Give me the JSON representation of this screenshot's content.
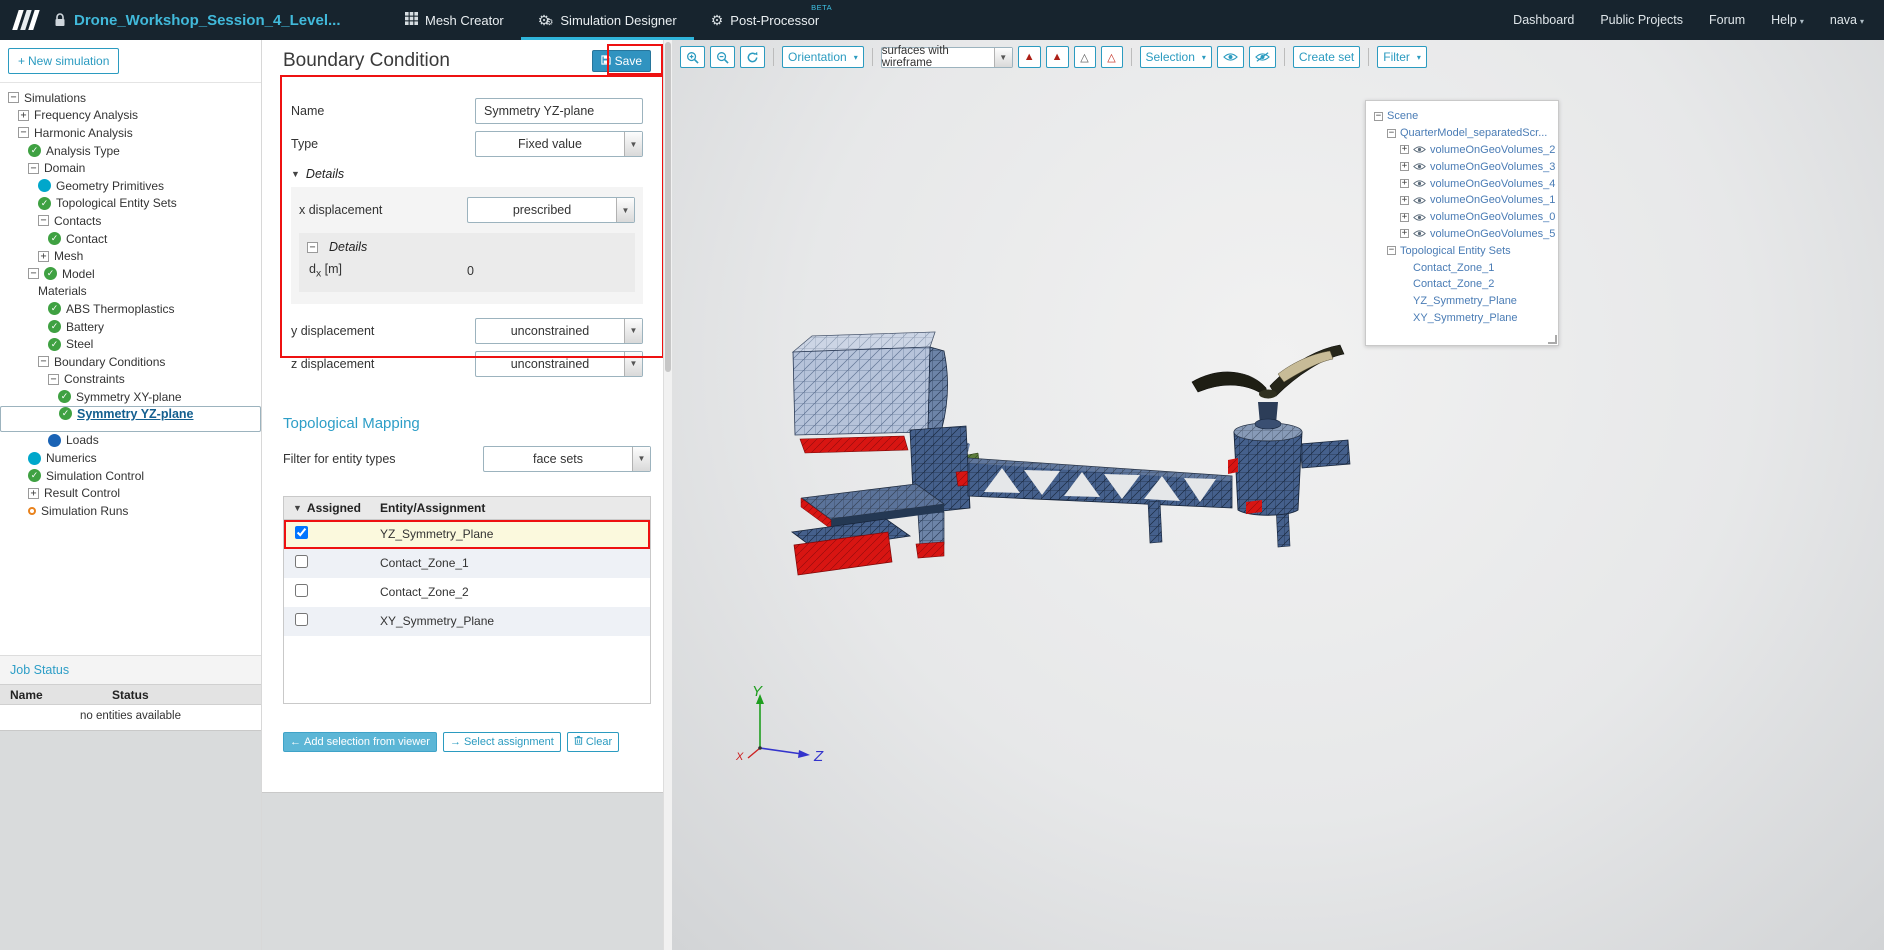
{
  "topbar": {
    "project_title": "Drone_Workshop_Session_4_Level...",
    "tabs": [
      {
        "label": "Mesh Creator"
      },
      {
        "label": "Simulation Designer"
      },
      {
        "label": "Post-Processor",
        "badge": "BETA"
      }
    ],
    "nav_links": [
      "Dashboard",
      "Public Projects",
      "Forum",
      "Help"
    ],
    "user_name": "nava"
  },
  "sidebar": {
    "new_simulation_label": "New simulation",
    "tree": [
      {
        "label": "Simulations",
        "depth": 0,
        "exp": "minus"
      },
      {
        "label": "Frequency Analysis",
        "depth": 1,
        "exp": "plus"
      },
      {
        "label": "Harmonic Analysis",
        "depth": 1,
        "exp": "minus"
      },
      {
        "label": "Analysis Type",
        "depth": 2,
        "status": "check"
      },
      {
        "label": "Domain",
        "depth": 2,
        "exp": "minus"
      },
      {
        "label": "Geometry Primitives",
        "depth": 3,
        "status": "dot-teal"
      },
      {
        "label": "Topological Entity Sets",
        "depth": 3,
        "status": "check"
      },
      {
        "label": "Contacts",
        "depth": 3,
        "exp": "minus"
      },
      {
        "label": "Contact",
        "depth": 4,
        "status": "check"
      },
      {
        "label": "Mesh",
        "depth": 3,
        "exp": "plus"
      },
      {
        "label": "Model",
        "depth": 2,
        "exp": "minus",
        "status": "check"
      },
      {
        "label": "Materials",
        "depth": 3
      },
      {
        "label": "ABS Thermoplastics",
        "depth": 4,
        "status": "check"
      },
      {
        "label": "Battery",
        "depth": 4,
        "status": "check"
      },
      {
        "label": "Steel",
        "depth": 4,
        "status": "check"
      },
      {
        "label": "Boundary Conditions",
        "depth": 3,
        "exp": "minus"
      },
      {
        "label": "Constraints",
        "depth": 4,
        "exp": "minus"
      },
      {
        "label": "Symmetry XY-plane",
        "depth": 5,
        "status": "check"
      },
      {
        "label": "Symmetry YZ-plane",
        "depth": 5,
        "status": "check",
        "selected": true
      },
      {
        "label": "Loads",
        "depth": 4,
        "status": "dot-blue"
      },
      {
        "label": "Numerics",
        "depth": 2,
        "status": "dot-teal"
      },
      {
        "label": "Simulation Control",
        "depth": 2,
        "status": "check"
      },
      {
        "label": "Result Control",
        "depth": 2,
        "exp": "plus"
      },
      {
        "label": "Simulation Runs",
        "depth": 2,
        "status": "ring-orange"
      }
    ],
    "job_status": {
      "title": "Job Status",
      "col_name": "Name",
      "col_status": "Status",
      "empty_text": "no entities available"
    }
  },
  "panel": {
    "title": "Boundary Condition",
    "save_label": "Save",
    "form": {
      "name_label": "Name",
      "name_value": "Symmetry YZ-plane",
      "type_label": "Type",
      "type_value": "Fixed value",
      "details_label": "Details",
      "x_label": "x displacement",
      "x_value": "prescribed",
      "inner_details_label": "Details",
      "dx_base": "d",
      "dx_sub": "x",
      "dx_unit": "[m]",
      "dx_value": "0",
      "y_label": "y displacement",
      "y_value": "unconstrained",
      "z_label": "z displacement",
      "z_value": "unconstrained"
    },
    "topo": {
      "title": "Topological Mapping",
      "filter_label": "Filter for entity types",
      "filter_value": "face sets",
      "col_assigned": "Assigned",
      "col_entity": "Entity/Assignment",
      "rows": [
        {
          "label": "YZ_Symmetry_Plane",
          "checked": true,
          "highlighted": true
        },
        {
          "label": "Contact_Zone_1",
          "checked": false
        },
        {
          "label": "Contact_Zone_2",
          "checked": false
        },
        {
          "label": "XY_Symmetry_Plane",
          "checked": false
        }
      ],
      "add_selection_label": "Add selection from viewer",
      "select_assignment_label": "Select assignment",
      "clear_label": "Clear"
    }
  },
  "viewer": {
    "toolbar": {
      "orientation_label": "Orientation",
      "render_mode_value": "surfaces with wireframe",
      "selection_label": "Selection",
      "create_set_label": "Create set",
      "filter_label": "Filter"
    },
    "scene_tree": [
      {
        "label": "Scene",
        "depth": 0,
        "exp": "minus"
      },
      {
        "label": "QuarterModel_separatedScr...",
        "depth": 1,
        "exp": "minus"
      },
      {
        "label": "volumeOnGeoVolumes_2",
        "depth": 2,
        "exp": "plus",
        "eye": true
      },
      {
        "label": "volumeOnGeoVolumes_3",
        "depth": 2,
        "exp": "plus",
        "eye": true
      },
      {
        "label": "volumeOnGeoVolumes_4",
        "depth": 2,
        "exp": "plus",
        "eye": true
      },
      {
        "label": "volumeOnGeoVolumes_1",
        "depth": 2,
        "exp": "plus",
        "eye": true
      },
      {
        "label": "volumeOnGeoVolumes_0",
        "depth": 2,
        "exp": "plus",
        "eye": true
      },
      {
        "label": "volumeOnGeoVolumes_5",
        "depth": 2,
        "exp": "plus",
        "eye": true
      },
      {
        "label": "Topological Entity Sets",
        "depth": 1,
        "exp": "minus"
      },
      {
        "label": "Contact_Zone_1",
        "depth": 3
      },
      {
        "label": "Contact_Zone_2",
        "depth": 3
      },
      {
        "label": "YZ_Symmetry_Plane",
        "depth": 3
      },
      {
        "label": "XY_Symmetry_Plane",
        "depth": 3
      }
    ],
    "axis_labels": {
      "x": "X",
      "y": "Y",
      "z": "Z"
    }
  },
  "colors": {
    "accent_teal": "#2b9bc0",
    "annotation_red": "#ee1111",
    "check_green": "#3fa142",
    "topbar_bg": "#17242e",
    "highlight_face_red": "#d81512"
  }
}
